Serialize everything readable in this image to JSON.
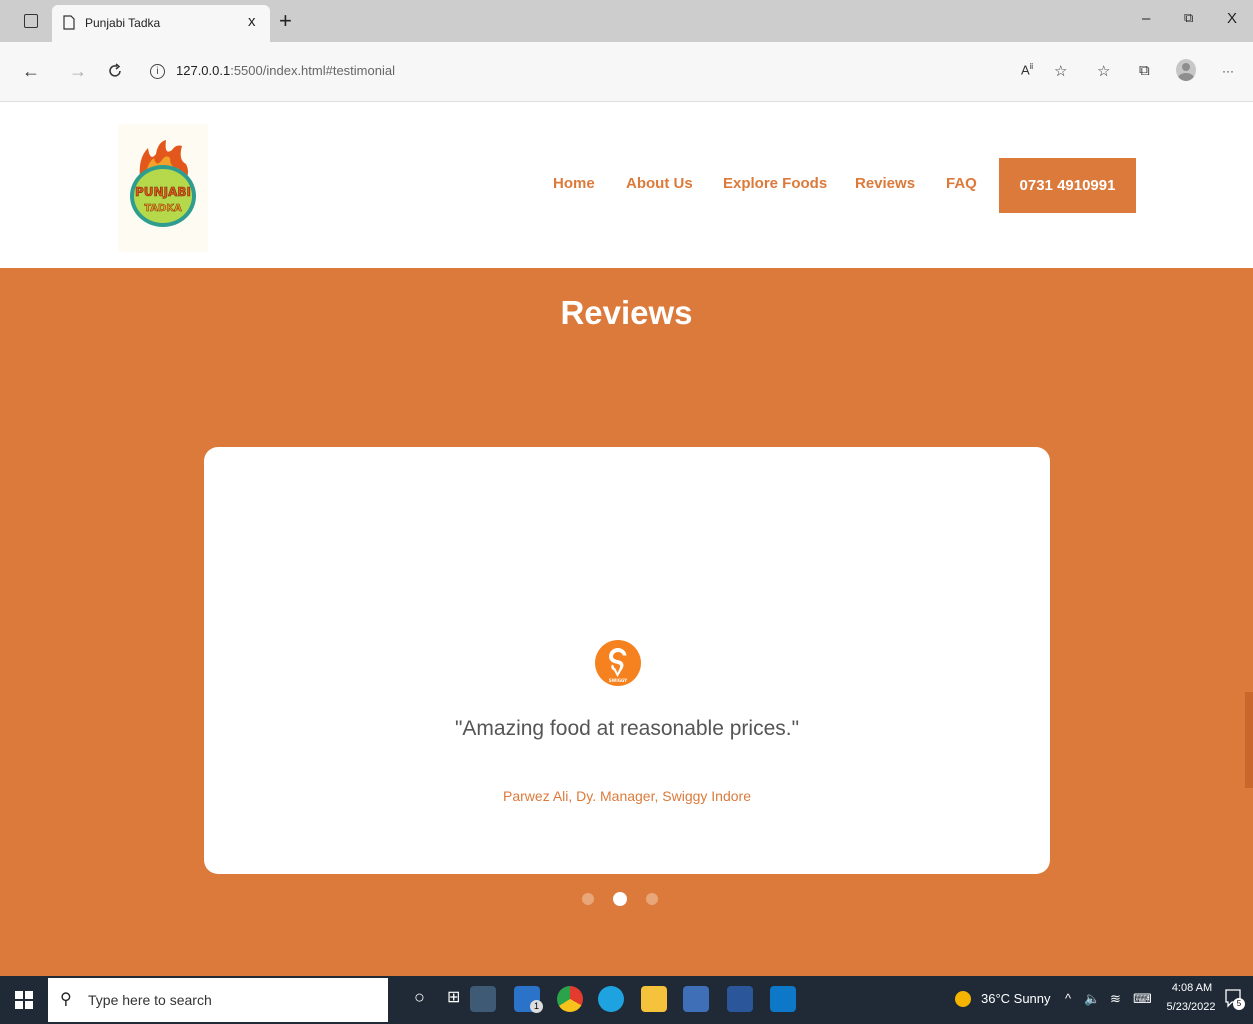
{
  "browser": {
    "tab_title": "Punjabi Tadka",
    "tab_close": "x",
    "new_tab": "+",
    "url_host": "127.0.0.1",
    "url_rest": ":5500/index.html#testimonial",
    "window_min": "–",
    "window_restore": "⧉",
    "window_close": "X",
    "more": "···"
  },
  "logo": {
    "line1": "PUNJABI",
    "line2": "TADKA"
  },
  "nav": {
    "items": [
      "Home",
      "About Us",
      "Explore Foods",
      "Reviews",
      "FAQ"
    ],
    "phone": "0731 4910991"
  },
  "reviews": {
    "title": "Reviews",
    "swiggy_label": "SWIGGY",
    "quote": "\"Amazing food at reasonable prices.\"",
    "author": "Parwez Ali, Dy. Manager, Swiggy Indore",
    "active_slide": 2,
    "slide_count": 3
  },
  "taskbar": {
    "search_placeholder": "Type here to search",
    "weather": "36°C  Sunny",
    "time": "4:08 AM",
    "date": "5/23/2022",
    "mail_badge": "1",
    "notif_count": "5"
  },
  "colors": {
    "brand": "#dc7a3b",
    "swiggy": "#f5821f"
  }
}
